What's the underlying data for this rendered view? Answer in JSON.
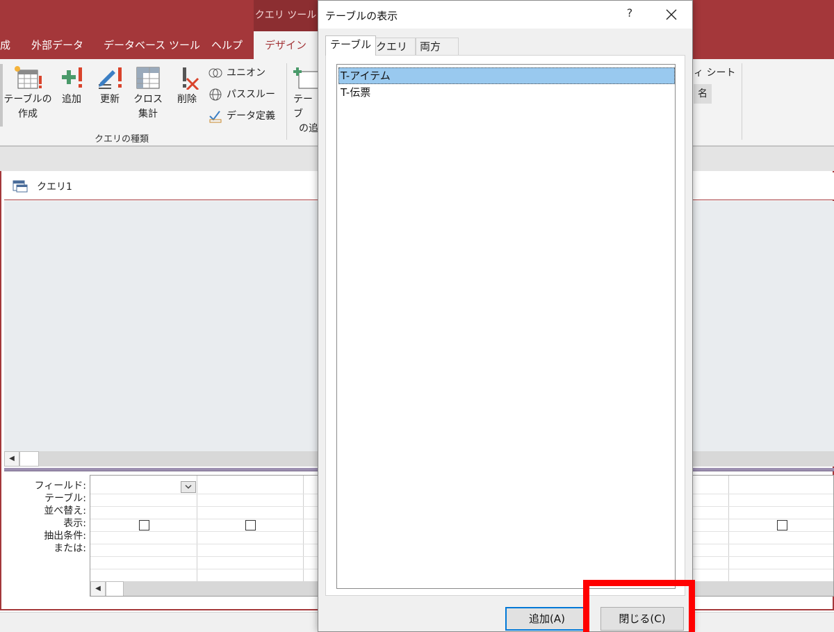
{
  "context_tab": {
    "label": "クエリ ツール"
  },
  "ribbon_tabs": [
    {
      "label": "成"
    },
    {
      "label": "外部データ"
    },
    {
      "label": "データベース ツール"
    },
    {
      "label": "ヘルプ"
    },
    {
      "label": "デザイン"
    }
  ],
  "ribbon": {
    "make_table": {
      "line1": "テーブルの",
      "line2": "作成"
    },
    "append": "追加",
    "update": "更新",
    "crosstab": {
      "line1": "クロス",
      "line2": "集計"
    },
    "delete": "削除",
    "union": "ユニオン",
    "pass_through": "パススルー",
    "data_definition": "データ定義",
    "group_label": "クエリの種類",
    "show_table_partial": {
      "line1": "テーブ",
      "line2": "の追"
    },
    "property_sheet_partial": "ィ シート",
    "table_names_partial": "名"
  },
  "document": {
    "tab_title": "クエリ1"
  },
  "grid_labels": [
    "フィールド:",
    "テーブル:",
    "並べ替え:",
    "表示:",
    "抽出条件:",
    "または:"
  ],
  "dialog": {
    "title": "テーブルの表示",
    "help": "?",
    "tabs": [
      "テーブル",
      "クエリ",
      "両方"
    ],
    "items": [
      "T-アイテム",
      "T-伝票"
    ],
    "add_button": "追加(A)",
    "close_button": "閉じる(C)"
  },
  "colors": {
    "accent": "#a4373a",
    "selection": "#99c9ef",
    "highlight": "#ff0000"
  }
}
